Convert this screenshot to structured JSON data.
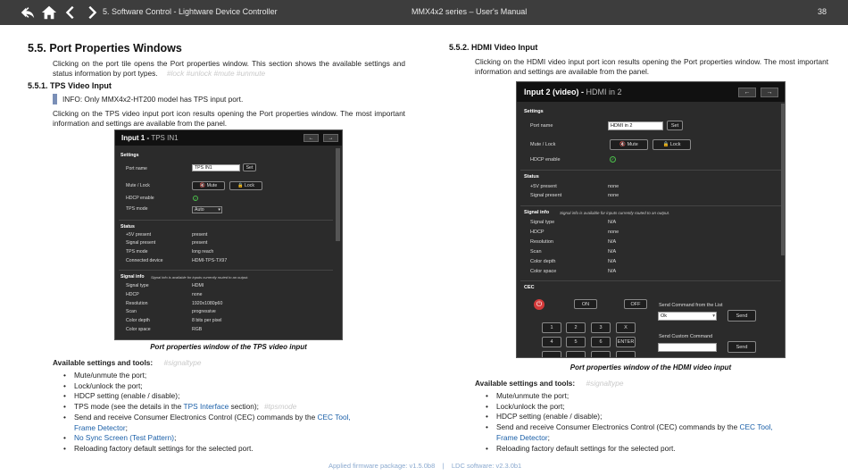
{
  "header": {
    "chapter": "5. Software Control - Lightware Device Controller",
    "doc_title": "MMX4x2 series – User's Manual",
    "page_number": "38",
    "nav_icons": [
      "back-all-icon",
      "home-icon",
      "prev-icon",
      "next-icon"
    ]
  },
  "left": {
    "section_title": "5.5. Port Properties Windows",
    "intro": "Clicking on the port tile opens the Port properties window. This section shows the available settings and status information by port types.",
    "intro_tags": "#lock   #unlock #mute   #unmute",
    "sub_title": "5.5.1. TPS Video Input",
    "info": "INFO: Only MMX4x2-HT200 model has TPS input port.",
    "para": "Clicking on the TPS video input port icon results opening the Port properties window. The most important information and settings are available from the panel.",
    "caption": "Port properties window of the TPS video input",
    "avail_label": "Available settings and tools:",
    "avail_tag": "#signaltype",
    "bullets": [
      {
        "text": "Mute/unmute the port;"
      },
      {
        "text": "Lock/unlock the port;"
      },
      {
        "text": "HDCP setting (enable / disable);"
      },
      {
        "pre": "TPS mode (see the details in the ",
        "link": "TPS Interface",
        "post": " section);",
        "tag": "#tpsmode"
      },
      {
        "pre": "Send and receive Consumer Electronics Control (CEC) commands by the ",
        "link": "CEC Tool,"
      },
      {
        "link": "Frame Detector",
        "post": ";",
        "cont": true
      },
      {
        "link": "No Sync Screen (Test Pattern)",
        "post": ";"
      },
      {
        "text": "Reloading factory default settings for the selected port."
      }
    ],
    "panel": {
      "title": "Input 1",
      "title_sub": "TPS IN1",
      "settings_label": "Settings",
      "port_name_label": "Port name",
      "port_name_value": "TPS IN1",
      "set_label": "Set",
      "mute_lock_label": "Mute / Lock",
      "mute_label": "Mute",
      "lock_label": "Lock",
      "hdcp_label": "HDCP enable",
      "tps_mode_label": "TPS mode",
      "tps_mode_value": "Auto",
      "status_label": "Status",
      "status_rows": [
        [
          "+5V present",
          "present"
        ],
        [
          "Signal present",
          "present"
        ],
        [
          "TPS mode",
          "long reach"
        ],
        [
          "Connected device",
          "HDMI-TPS-TX97"
        ]
      ],
      "signal_label": "Signal info",
      "signal_note": "Signal info is available for inputs currently routed to an output.",
      "signal_rows": [
        [
          "Signal type",
          "HDMI"
        ],
        [
          "HDCP",
          "none"
        ],
        [
          "Resolution",
          "1920x1080p60"
        ],
        [
          "Scan",
          "progressive"
        ],
        [
          "Color depth",
          "8 bits per pixel"
        ],
        [
          "Color space",
          "RGB"
        ]
      ]
    }
  },
  "right": {
    "sub_title": "5.5.2. HDMI Video Input",
    "para": "Clicking on the HDMI video input port icon results opening the Port properties window. The most important information and settings are available from the panel.",
    "caption": "Port properties window of the HDMI video input",
    "avail_label": "Available settings and tools:",
    "avail_tag": "#signaltype",
    "bullets": [
      {
        "text": "Mute/unmute the port;"
      },
      {
        "text": "Lock/unlock the port;"
      },
      {
        "text": "HDCP setting (enable / disable);"
      },
      {
        "pre": "Send and receive Consumer Electronics Control (CEC) commands by the ",
        "link": "CEC Tool,"
      },
      {
        "link": "Frame Detector",
        "post": ";",
        "cont": true
      },
      {
        "text": "Reloading factory default settings for the selected port."
      }
    ],
    "panel": {
      "title": "Input 2 (video)",
      "title_sub": "HDMI in 2",
      "settings_label": "Settings",
      "port_name_label": "Port name",
      "port_name_value": "HDMI in 2",
      "set_label": "Set",
      "mute_lock_label": "Mute / Lock",
      "mute_label": "Mute",
      "lock_label": "Lock",
      "hdcp_label": "HDCP enable",
      "status_label": "Status",
      "status_rows": [
        [
          "+5V present",
          "none"
        ],
        [
          "Signal present",
          "none"
        ]
      ],
      "signal_label": "Signal info",
      "signal_note": "Signal info is available for inputs currently routed to an output.",
      "signal_rows": [
        [
          "Signal type",
          "N/A"
        ],
        [
          "HDCP",
          "none"
        ],
        [
          "Resolution",
          "N/A"
        ],
        [
          "Scan",
          "N/A"
        ],
        [
          "Color depth",
          "N/A"
        ],
        [
          "Color space",
          "N/A"
        ]
      ],
      "cec_label": "CEC",
      "on_label": "ON",
      "off_label": "OFF",
      "send_list_label": "Send Command from the List",
      "send_list_value": "Ok",
      "send_label": "Send",
      "custom_label": "Send Custom Command",
      "custom_value": "",
      "keypad": [
        "1",
        "2",
        "3",
        "X",
        "4",
        "5",
        "6",
        "ENTER"
      ]
    }
  },
  "footer": {
    "text": "Applied firmware package: v1.5.0b8    |    LDC software: v2.3.0b1"
  },
  "colors": {
    "header_bg": "#3d3d3d",
    "link": "#1a5fa8",
    "info_bar": "#7a8fb7",
    "panel_bg": "#2b2b2b",
    "footer": "#8aa9cf",
    "cec_power": "#d43a3a",
    "hdcp_check": "#4cc04c"
  }
}
